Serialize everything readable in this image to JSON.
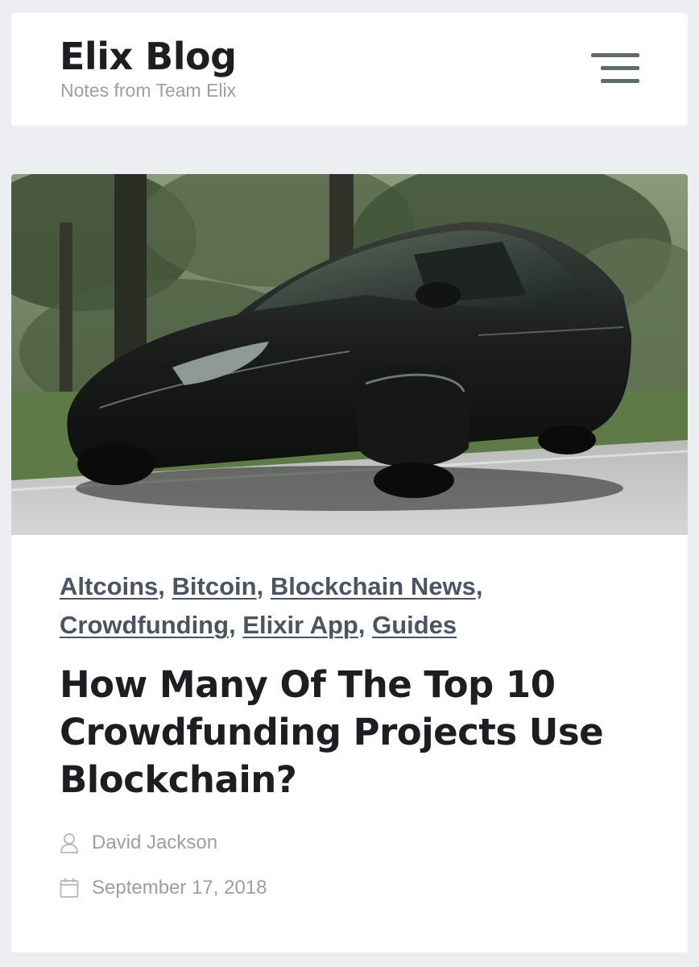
{
  "site": {
    "title": "Elix Blog",
    "tagline": "Notes from Team Elix",
    "menu_icon": "hamburger-menu-icon"
  },
  "post": {
    "categories": [
      {
        "label": "Altcoins"
      },
      {
        "label": "Bitcoin"
      },
      {
        "label": "Blockchain News"
      },
      {
        "label": "Crowdfunding"
      },
      {
        "label": "Elixir App"
      },
      {
        "label": "Guides"
      }
    ],
    "separator": ", ",
    "title": "How Many Of The Top 10 Crowdfunding Projects Use Blockchain?",
    "author": "David Jackson",
    "date": "September 17, 2018",
    "author_icon": "user-icon",
    "date_icon": "calendar-icon"
  },
  "colors": {
    "page_background": "#eceef2",
    "card_background": "#ffffff",
    "title_text": "#1c1e21",
    "category_link": "#4b5561",
    "muted_text": "#9aa0a6",
    "menu_icon": "#5f6b73"
  }
}
